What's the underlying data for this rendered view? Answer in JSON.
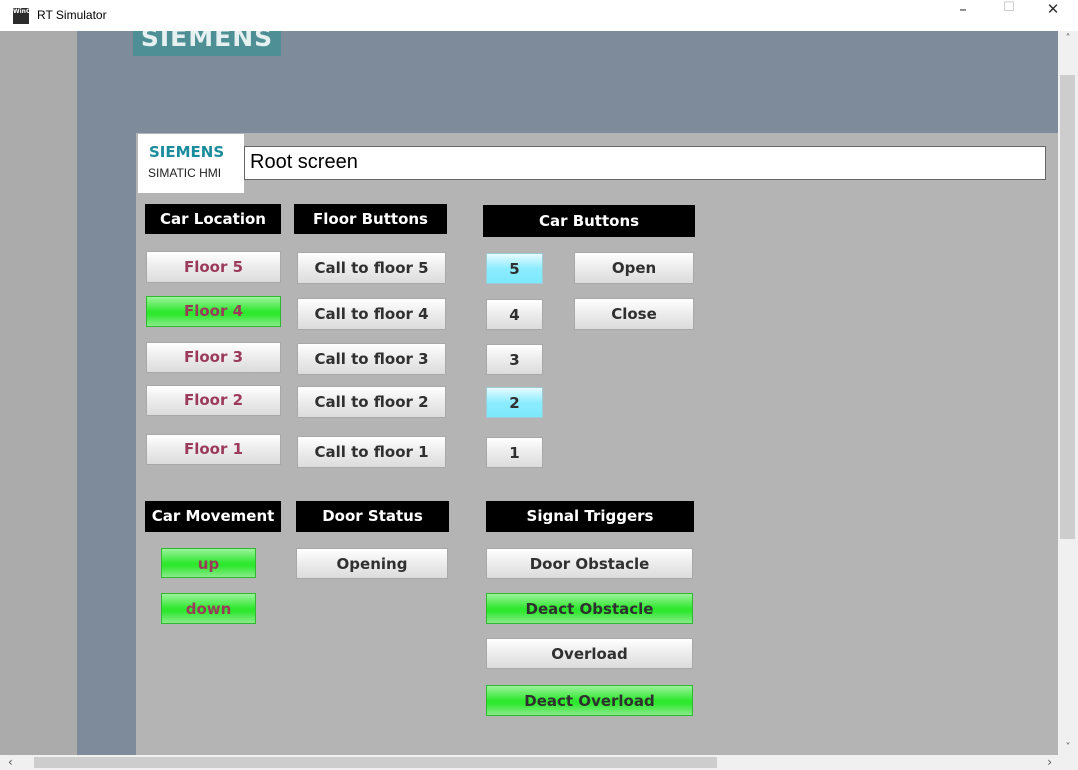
{
  "window": {
    "app_icon": "WinCC",
    "title": "RT Simulator",
    "minimize": "–",
    "maximize": "☐",
    "close": "✕"
  },
  "brand": {
    "banner_text": "SIEMENS"
  },
  "hmi": {
    "logo_brand": "SIEMENS",
    "logo_product": "SIMATIC HMI",
    "screen_selector": "Root screen"
  },
  "car_location": {
    "header": "Car Location",
    "floors": [
      {
        "label": "Floor 5",
        "active": false
      },
      {
        "label": "Floor 4",
        "active": true
      },
      {
        "label": "Floor 3",
        "active": false
      },
      {
        "label": "Floor 2",
        "active": false
      },
      {
        "label": "Floor 1",
        "active": false
      }
    ]
  },
  "floor_buttons": {
    "header": "Floor Buttons",
    "calls": [
      "Call to floor 5",
      "Call to floor 4",
      "Call to floor 3",
      "Call to floor 2",
      "Call to floor 1"
    ]
  },
  "car_buttons": {
    "header": "Car Buttons",
    "numbers": [
      {
        "label": "5",
        "selected": true
      },
      {
        "label": "4",
        "selected": false
      },
      {
        "label": "3",
        "selected": false
      },
      {
        "label": "2",
        "selected": true
      },
      {
        "label": "1",
        "selected": false
      }
    ],
    "open": "Open",
    "close": "Close"
  },
  "car_movement": {
    "header": "Car Movement",
    "up": "up",
    "up_active": true,
    "down": "down",
    "down_active": true
  },
  "door_status": {
    "header": "Door Status",
    "value": "Opening"
  },
  "signal_triggers": {
    "header": "Signal Triggers",
    "door_obstacle": "Door Obstacle",
    "deact_obstacle": "Deact Obstacle",
    "overload": "Overload",
    "deact_overload": "Deact Overload"
  },
  "scrollbars": {
    "up": "˄",
    "down": "˅",
    "left": "‹",
    "right": "›"
  },
  "colors": {
    "active_green": "#2ee82e",
    "selected_cyan": "#8cecff",
    "floor_text": "#9b3a5a",
    "siemens_teal": "#1a8c9c"
  }
}
